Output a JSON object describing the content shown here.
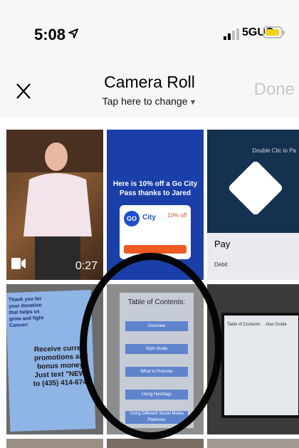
{
  "status_bar": {
    "time": "5:08",
    "network": "5GUC",
    "icons": [
      "location-arrow-icon",
      "signal-bars-icon",
      "battery-icon"
    ],
    "battery_color": "#f2d21b"
  },
  "nav": {
    "close_label": "X",
    "title": "Camera Roll",
    "subtitle": "Tap here to change",
    "done_label": "Done"
  },
  "grid": {
    "tiles": [
      {
        "kind": "video",
        "duration": "0:27",
        "icon": "video-camera-icon"
      },
      {
        "kind": "image",
        "promo_text": "Here is 10% off a Go City Pass thanks to Jared",
        "logo_text": "GO",
        "card_label": "City",
        "discount": "10% off"
      },
      {
        "kind": "image",
        "side_text": "Double Clic to Pa",
        "pay_label": "Pay",
        "card_label": "Debit"
      },
      {
        "kind": "image",
        "flyer_head": "Thank you for your donation that helps us grow and fight Cancer!",
        "flyer_text": "Receive current promotions and bonus money! Just text \"NEW\" to (435) 414-6747"
      },
      {
        "kind": "image",
        "board_title": "Table of Contents:",
        "items": [
          "Overview",
          "Style Guide",
          "What to Promote",
          "Using Hashtags",
          "Using Different Social Media Platforms"
        ]
      },
      {
        "kind": "image",
        "screen_left": "Table of Contents",
        "screen_right": "Alan Guide"
      }
    ]
  },
  "colors": {
    "accent_done": "#c7c7cc",
    "annotation": "#050505"
  }
}
